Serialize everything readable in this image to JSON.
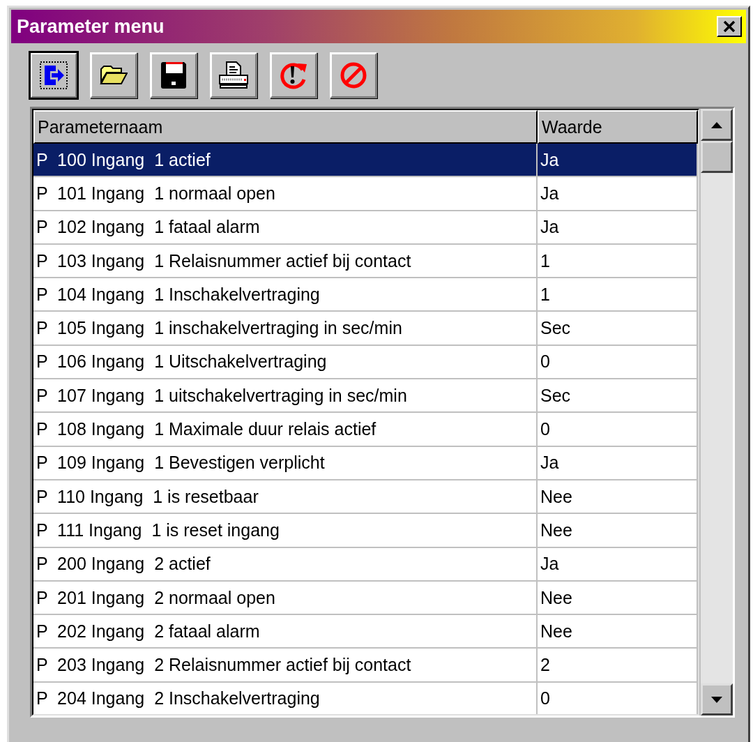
{
  "window": {
    "title": "Parameter menu"
  },
  "toolbar": [
    {
      "kind": "exit",
      "focused": true
    },
    {
      "kind": "open",
      "focused": false
    },
    {
      "kind": "save",
      "focused": false
    },
    {
      "kind": "print",
      "focused": false
    },
    {
      "kind": "reset",
      "focused": false
    },
    {
      "kind": "cancel",
      "focused": false
    }
  ],
  "table": {
    "columns": [
      "Parameternaam",
      "Waarde"
    ],
    "rows": [
      {
        "name": "P  100 Ingang  1 actief",
        "value": "Ja",
        "selected": true
      },
      {
        "name": "P  101 Ingang  1 normaal open",
        "value": "Ja",
        "selected": false
      },
      {
        "name": "P  102 Ingang  1 fataal alarm",
        "value": "Ja",
        "selected": false
      },
      {
        "name": "P  103 Ingang  1 Relaisnummer actief bij contact",
        "value": "1",
        "selected": false
      },
      {
        "name": "P  104 Ingang  1 Inschakelvertraging",
        "value": "1",
        "selected": false
      },
      {
        "name": "P  105 Ingang  1 inschakelvertraging in sec/min",
        "value": "Sec",
        "selected": false
      },
      {
        "name": "P  106 Ingang  1 Uitschakelvertraging",
        "value": "0",
        "selected": false
      },
      {
        "name": "P  107 Ingang  1 uitschakelvertraging in sec/min",
        "value": "Sec",
        "selected": false
      },
      {
        "name": "P  108 Ingang  1 Maximale duur relais actief",
        "value": "0",
        "selected": false
      },
      {
        "name": "P  109 Ingang  1 Bevestigen verplicht",
        "value": "Ja",
        "selected": false
      },
      {
        "name": "P  110 Ingang  1 is resetbaar",
        "value": "Nee",
        "selected": false
      },
      {
        "name": "P  111 Ingang  1 is reset ingang",
        "value": "Nee",
        "selected": false
      },
      {
        "name": "P  200 Ingang  2 actief",
        "value": "Ja",
        "selected": false
      },
      {
        "name": "P  201 Ingang  2 normaal open",
        "value": "Nee",
        "selected": false
      },
      {
        "name": "P  202 Ingang  2 fataal alarm",
        "value": "Nee",
        "selected": false
      },
      {
        "name": "P  203 Ingang  2 Relaisnummer actief bij contact",
        "value": "2",
        "selected": false
      },
      {
        "name": "P  204 Ingang  2 Inschakelvertraging",
        "value": "0",
        "selected": false
      }
    ]
  }
}
